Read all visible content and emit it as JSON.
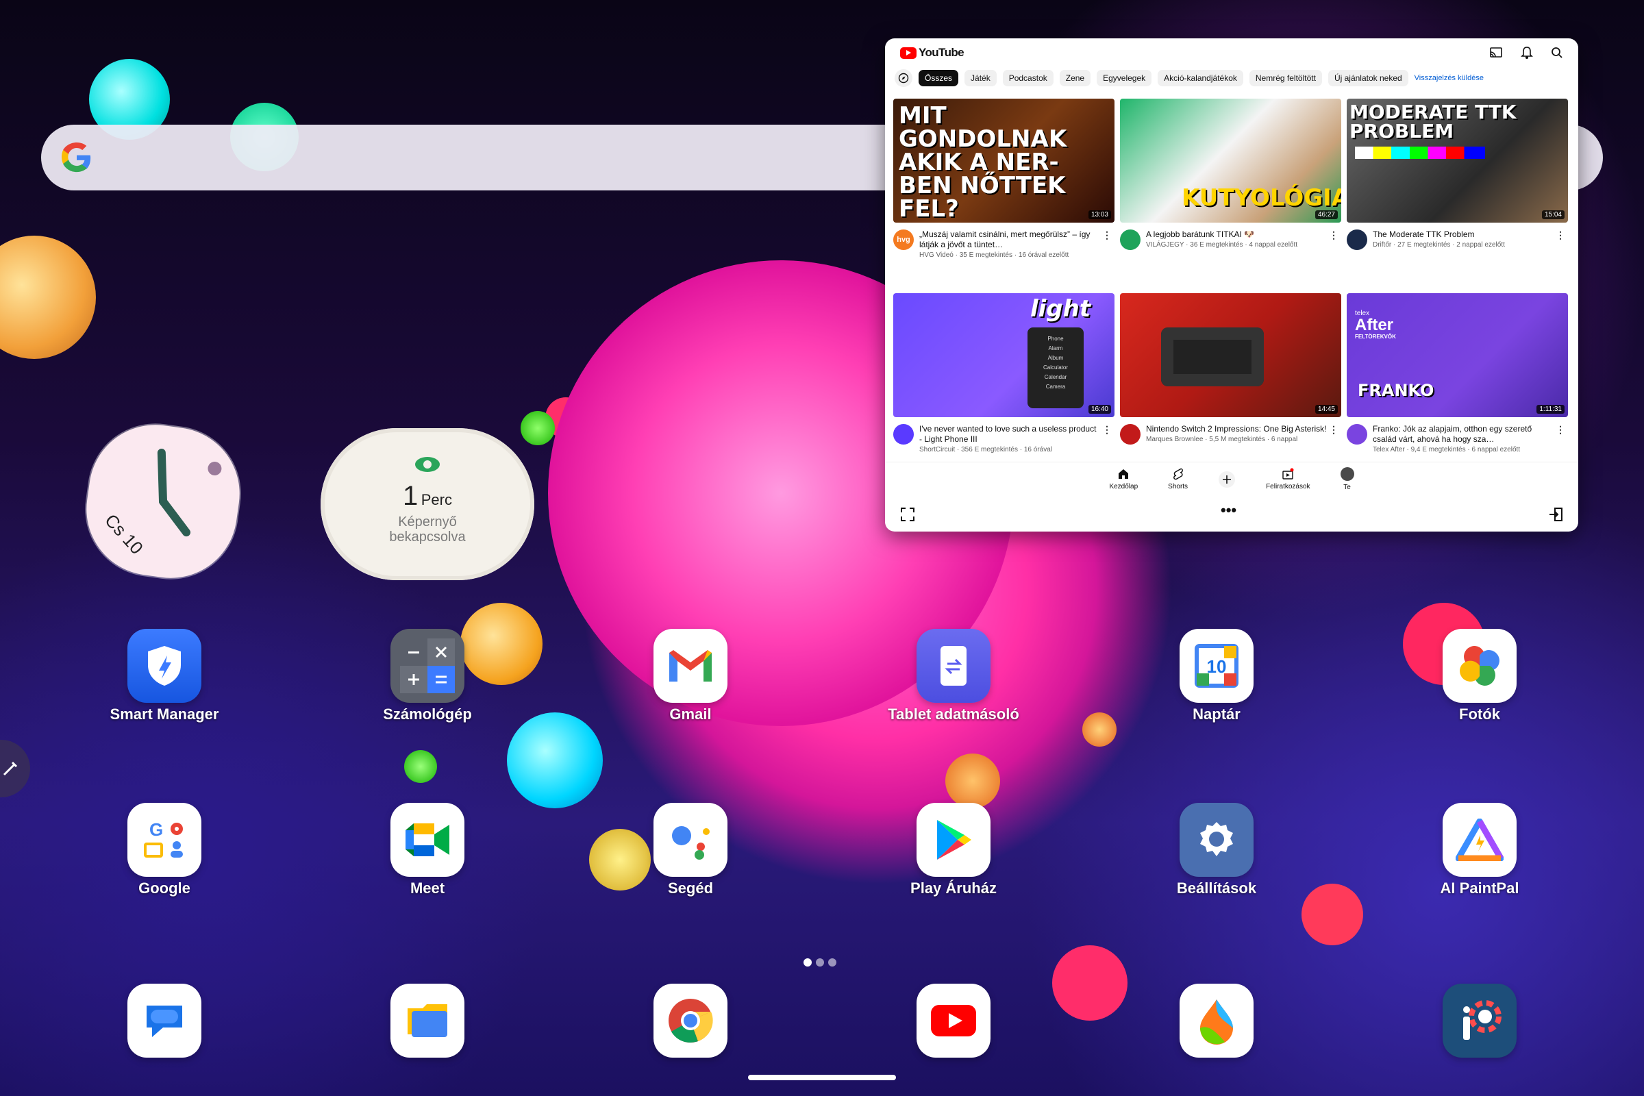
{
  "clock": {
    "date": "Cs 10"
  },
  "timer": {
    "count": "1",
    "unit": "Perc",
    "line1": "Képernyő",
    "line2": "bekapcsolva"
  },
  "apps_row1": [
    {
      "label": "Smart Manager",
      "icon": "shield-icon"
    },
    {
      "label": "Számológép",
      "icon": "calculator-icon"
    },
    {
      "label": "Gmail",
      "icon": "gmail-icon"
    },
    {
      "label": "Tablet adatmásoló",
      "icon": "clone-icon"
    },
    {
      "label": "Naptár",
      "icon": "calendar-icon"
    },
    {
      "label": "Fotók",
      "icon": "photos-icon"
    }
  ],
  "apps_row2": [
    {
      "label": "Google",
      "icon": "google-folder-icon"
    },
    {
      "label": "Meet",
      "icon": "meet-icon"
    },
    {
      "label": "Segéd",
      "icon": "assistant-icon"
    },
    {
      "label": "Play Áruház",
      "icon": "play-store-icon"
    },
    {
      "label": "Beállítások",
      "icon": "settings-icon"
    },
    {
      "label": "AI PaintPal",
      "icon": "paintpal-icon"
    }
  ],
  "dock": [
    {
      "icon": "messages-icon"
    },
    {
      "icon": "files-icon"
    },
    {
      "icon": "chrome-icon"
    },
    {
      "icon": "youtube-icon"
    },
    {
      "icon": "paint-drop-icon"
    },
    {
      "icon": "ibispaint-icon"
    }
  ],
  "calendar_day": "10",
  "youtube": {
    "logo_text": "YouTube",
    "chips": [
      "Összes",
      "Játék",
      "Podcastok",
      "Zene",
      "Egyvelegek",
      "Akció-kalandjátékok",
      "Nemrég feltöltött",
      "Új ajánlatok neked"
    ],
    "feedback_link": "Visszajelzés küldése",
    "videos": [
      {
        "thumb_text": "MIT GONDOLNAK AKIK A NER-BEN NŐTTEK FEL?",
        "duration": "13:03",
        "avatar": "hvg",
        "title": "„Muszáj valamit csinálni, mert megőrülsz” – így látják a jövőt a tüntet…",
        "channel": "HVG Videó · 35 E megtekintés · 16 órával ezelőtt"
      },
      {
        "thumb_text": "KUTYOLÓGIA",
        "duration": "46:27",
        "avatar": "",
        "title": "A legjobb barátunk TITKAI 🐶",
        "channel": "VILÁGJEGY · 36 E megtekintés · 4 nappal ezelőtt"
      },
      {
        "thumb_text": "MODERATE TTK PROBLEM",
        "duration": "15:04",
        "avatar": "",
        "title": "The Moderate TTK Problem",
        "channel": "Driftőr · 27 E megtekintés · 2 nappal ezelőtt"
      },
      {
        "thumb_text": "light",
        "duration": "16:40",
        "avatar": "",
        "title": "I've never wanted to love such a useless product - Light Phone III",
        "channel": "ShortCircuit · 356 E megtekintés · 16 órával"
      },
      {
        "thumb_text": "",
        "duration": "14:45",
        "avatar": "",
        "title": "Nintendo Switch 2 Impressions: One Big Asterisk!",
        "channel": "Marques Brownlee · 5,5 M megtekintés · 6 nappal"
      },
      {
        "thumb_text": "FRANKO",
        "duration": "1:11:31",
        "avatar": "",
        "title": "Franko: Jók az alapjaim, otthon egy szerető család várt, ahová ha hogy sza…",
        "channel": "Telex After · 9,4 E megtekintés · 6 nappal ezelőtt"
      }
    ],
    "light_menu": [
      "Phone",
      "Alarm",
      "Album",
      "Calculator",
      "Calendar",
      "Camera"
    ],
    "telex_line1": "telex",
    "telex_line2": "After",
    "telex_line3": "FELTÖREKVŐK",
    "nav": [
      "Kezdőlap",
      "Shorts",
      "",
      "Feliratkozások",
      "Te"
    ]
  },
  "colors": {
    "accent_pink": "#ff2fa6",
    "youtube_red": "#ff0000",
    "chip_active": "#0f0f0f"
  }
}
